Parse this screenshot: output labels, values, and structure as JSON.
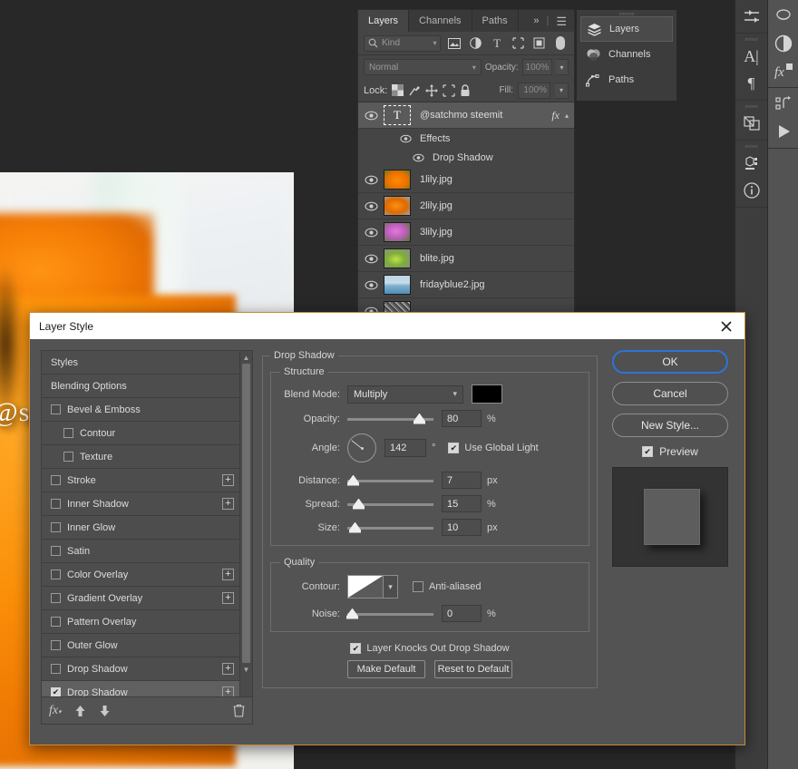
{
  "canvas": {
    "watermark_text": "@satchmo steemit"
  },
  "layers_panel": {
    "tabs": [
      {
        "label": "Layers",
        "active": true
      },
      {
        "label": "Channels",
        "active": false
      },
      {
        "label": "Paths",
        "active": false
      }
    ],
    "collapse_icon": "double-chevron-right-icon",
    "menu_icon": "panel-menu-icon",
    "filter": {
      "search_icon": "search-icon",
      "kind_label": "Kind",
      "chevron": "chevron-down-icon",
      "type_filters": [
        "pixel-layer-icon",
        "adjustment-layer-icon",
        "type-layer-icon",
        "shape-layer-icon",
        "smart-object-icon"
      ],
      "toggle_icon": "filter-toggle-icon"
    },
    "blend": {
      "mode": "Normal",
      "opacity_label": "Opacity:",
      "opacity_value": "100%"
    },
    "lock": {
      "label": "Lock:",
      "icons": [
        "lock-transparent-pixels-icon",
        "lock-image-pixels-icon",
        "lock-position-icon",
        "lock-artboard-icon",
        "lock-all-icon"
      ],
      "fill_label": "Fill:",
      "fill_value": "100%"
    },
    "layers": [
      {
        "name": "@satchmo steemit",
        "type": "text",
        "selected": true,
        "visible": true,
        "has_fx": true,
        "fx_mark": "fx"
      },
      {
        "name": "1lily.jpg",
        "type": "image",
        "thumb": "t-lily1",
        "visible": true
      },
      {
        "name": "2lily.jpg",
        "type": "image",
        "thumb": "t-lily2",
        "visible": true
      },
      {
        "name": "3lily.jpg",
        "type": "image",
        "thumb": "t-lily3",
        "visible": true
      },
      {
        "name": "blite.jpg",
        "type": "image",
        "thumb": "t-blite",
        "visible": true
      },
      {
        "name": "fridayblue2.jpg",
        "type": "image",
        "thumb": "t-friday",
        "visible": true
      },
      {
        "name": "",
        "type": "image",
        "thumb": "t-noise",
        "visible": true
      }
    ],
    "effects": {
      "group_label": "Effects",
      "items": [
        "Drop Shadow"
      ]
    }
  },
  "flyout_menu": {
    "items": [
      {
        "label": "Layers",
        "icon": "layers-stack-icon",
        "highlighted": true
      },
      {
        "label": "Channels",
        "icon": "channels-circles-icon",
        "highlighted": false
      },
      {
        "label": "Paths",
        "icon": "paths-pen-icon",
        "highlighted": false
      }
    ]
  },
  "toolbars": {
    "left_rail_icons": [
      "adjustments-sliders-icon",
      "character-panel-icon",
      "paragraph-panel-icon",
      "layer-comps-icon",
      "3d-panel-icon",
      "info-panel-icon"
    ],
    "right_rail_icons": [
      "history-brush-icon",
      "adjustment-half-circle-icon",
      "fx-styles-icon",
      "actions-icon",
      "play-icon"
    ]
  },
  "dialog": {
    "title": "Layer Style",
    "close_icon": "close-icon",
    "styles_list": [
      {
        "label": "Styles",
        "type": "plain",
        "checkbox": false,
        "checked": false,
        "plus": false,
        "indent": false,
        "selected": false
      },
      {
        "label": "Blending Options",
        "type": "plain",
        "checkbox": false,
        "checked": false,
        "plus": false,
        "indent": false,
        "selected": false
      },
      {
        "label": "Bevel & Emboss",
        "type": "check",
        "checkbox": true,
        "checked": false,
        "plus": false,
        "indent": false,
        "selected": false
      },
      {
        "label": "Contour",
        "type": "check",
        "checkbox": true,
        "checked": false,
        "plus": false,
        "indent": true,
        "selected": false
      },
      {
        "label": "Texture",
        "type": "check",
        "checkbox": true,
        "checked": false,
        "plus": false,
        "indent": true,
        "selected": false
      },
      {
        "label": "Stroke",
        "type": "check",
        "checkbox": true,
        "checked": false,
        "plus": true,
        "indent": false,
        "selected": false
      },
      {
        "label": "Inner Shadow",
        "type": "check",
        "checkbox": true,
        "checked": false,
        "plus": true,
        "indent": false,
        "selected": false
      },
      {
        "label": "Inner Glow",
        "type": "check",
        "checkbox": true,
        "checked": false,
        "plus": false,
        "indent": false,
        "selected": false
      },
      {
        "label": "Satin",
        "type": "check",
        "checkbox": true,
        "checked": false,
        "plus": false,
        "indent": false,
        "selected": false
      },
      {
        "label": "Color Overlay",
        "type": "check",
        "checkbox": true,
        "checked": false,
        "plus": true,
        "indent": false,
        "selected": false
      },
      {
        "label": "Gradient Overlay",
        "type": "check",
        "checkbox": true,
        "checked": false,
        "plus": true,
        "indent": false,
        "selected": false
      },
      {
        "label": "Pattern Overlay",
        "type": "check",
        "checkbox": true,
        "checked": false,
        "plus": false,
        "indent": false,
        "selected": false
      },
      {
        "label": "Outer Glow",
        "type": "check",
        "checkbox": true,
        "checked": false,
        "plus": false,
        "indent": false,
        "selected": false
      },
      {
        "label": "Drop Shadow",
        "type": "check",
        "checkbox": true,
        "checked": false,
        "plus": true,
        "indent": false,
        "selected": false
      },
      {
        "label": "Drop Shadow",
        "type": "check",
        "checkbox": true,
        "checked": true,
        "plus": true,
        "indent": false,
        "selected": true
      }
    ],
    "styles_footer": {
      "fx_icon": "fx-add-effect-icon",
      "up_icon": "move-up-icon",
      "down_icon": "move-down-icon",
      "trash_icon": "delete-icon"
    },
    "drop_shadow": {
      "section_title": "Drop Shadow",
      "structure": {
        "title": "Structure",
        "blend_mode_label": "Blend Mode:",
        "blend_mode_value": "Multiply",
        "shadow_color": "#000000",
        "opacity_label": "Opacity:",
        "opacity_value": "80",
        "opacity_unit": "%",
        "opacity_percent": 80,
        "angle_label": "Angle:",
        "angle_value": "142",
        "angle_unit": "°",
        "use_global_light_label": "Use Global Light",
        "use_global_light_checked": true,
        "distance_label": "Distance:",
        "distance_value": "7",
        "distance_unit": "px",
        "distance_percent": 7,
        "spread_label": "Spread:",
        "spread_value": "15",
        "spread_unit": "%",
        "spread_percent": 15,
        "size_label": "Size:",
        "size_value": "10",
        "size_unit": "px",
        "size_percent": 10
      },
      "quality": {
        "title": "Quality",
        "contour_label": "Contour:",
        "contour_preset": "linear",
        "anti_aliased_label": "Anti-aliased",
        "anti_aliased_checked": false,
        "noise_label": "Noise:",
        "noise_value": "0",
        "noise_unit": "%",
        "noise_percent": 0
      },
      "knockout_label": "Layer Knocks Out Drop Shadow",
      "knockout_checked": true,
      "make_default_label": "Make Default",
      "reset_default_label": "Reset to Default"
    },
    "buttons": {
      "ok": "OK",
      "cancel": "Cancel",
      "new_style": "New Style...",
      "preview_label": "Preview",
      "preview_checked": true
    },
    "accent_focus_color": "#2f72d8",
    "border_color": "#c88a3a"
  }
}
